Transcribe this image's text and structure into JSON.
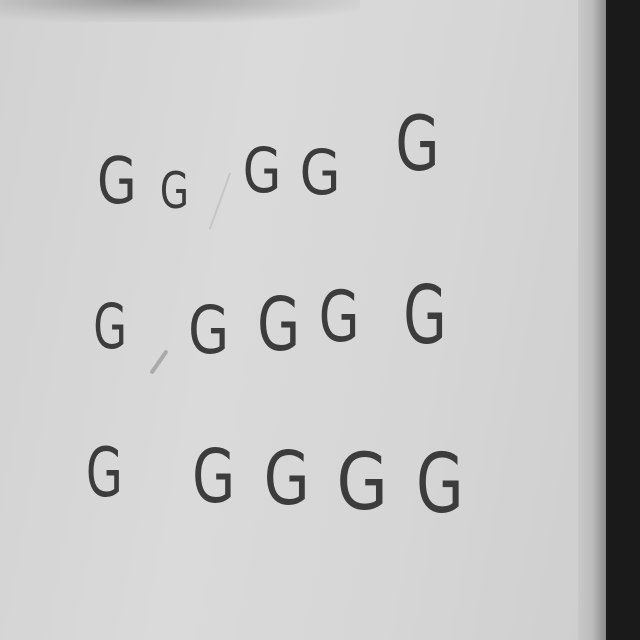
{
  "rows": [
    {
      "letters": [
        "G",
        "G",
        "G",
        "G",
        "G"
      ]
    },
    {
      "letters": [
        "G",
        "G",
        "G",
        "G",
        "G"
      ]
    },
    {
      "letters": [
        "G",
        "G",
        "G",
        "G",
        "G"
      ]
    }
  ],
  "colors": {
    "board": "#d6d6d6",
    "ink": "#3c3c3c",
    "background": "#1a1a1a"
  }
}
